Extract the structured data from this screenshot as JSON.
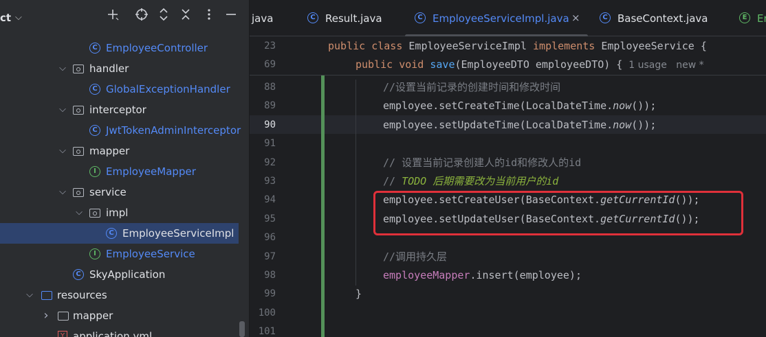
{
  "project_panel": {
    "title": "ct",
    "toolbar_icons": [
      "plus-icon",
      "crosshair-icon",
      "expand-icon",
      "collapse-icon",
      "more-icon",
      "minimize-icon"
    ],
    "tree": [
      {
        "label": "EmployeeController",
        "kind": "class",
        "expanded": null
      },
      {
        "label": "handler",
        "kind": "package",
        "expanded": true
      },
      {
        "label": "GlobalExceptionHandler",
        "kind": "class",
        "expanded": null
      },
      {
        "label": "interceptor",
        "kind": "package",
        "expanded": true
      },
      {
        "label": "JwtTokenAdminInterceptor",
        "kind": "class",
        "expanded": null
      },
      {
        "label": "mapper",
        "kind": "package",
        "expanded": true
      },
      {
        "label": "EmployeeMapper",
        "kind": "interface",
        "expanded": null
      },
      {
        "label": "service",
        "kind": "package",
        "expanded": true
      },
      {
        "label": "impl",
        "kind": "package",
        "expanded": true
      },
      {
        "label": "EmployeeServiceImpl",
        "kind": "class",
        "expanded": null,
        "selected": true
      },
      {
        "label": "EmployeeService",
        "kind": "interface",
        "expanded": null
      },
      {
        "label": "SkyApplication",
        "kind": "app",
        "expanded": null
      },
      {
        "label": "resources",
        "kind": "resources-folder",
        "expanded": true
      },
      {
        "label": "mapper",
        "kind": "folder",
        "expanded": false
      },
      {
        "label": "application.yml",
        "kind": "yaml",
        "expanded": null
      }
    ]
  },
  "editor": {
    "tabs": [
      {
        "label": "java",
        "icon": "none",
        "active": false
      },
      {
        "label": "Result.java",
        "icon": "class-icon",
        "active": false
      },
      {
        "label": "EmployeeServiceImpl.java",
        "icon": "class-icon",
        "active": true,
        "close": "×"
      },
      {
        "label": "BaseContext.java",
        "icon": "class-icon",
        "active": false
      },
      {
        "label": "Er",
        "icon": "enum-icon",
        "active": false
      }
    ],
    "sticky_lines": [
      {
        "num": "23",
        "parts": [
          [
            "public class ",
            "kw"
          ],
          [
            "EmployeeServiceImpl ",
            "cls"
          ],
          [
            "implements ",
            "kw"
          ],
          [
            "EmployeeService {",
            "plain"
          ]
        ]
      },
      {
        "num": "69",
        "parts": [
          [
            "public void ",
            "kw"
          ],
          [
            "save",
            "fn"
          ],
          [
            "(EmployeeDTO employeeDTO) {",
            "plain"
          ]
        ],
        "hints": [
          "1 usage",
          "new *"
        ]
      }
    ],
    "lines": [
      {
        "num": "88",
        "parts": [
          [
            "//设置当前记录的创建时间和修改时间",
            "cm"
          ]
        ]
      },
      {
        "num": "89",
        "parts": [
          [
            "employee.setCreateTime(LocalDateTime.",
            "plain"
          ],
          [
            "now",
            "st"
          ],
          [
            "());",
            "plain"
          ]
        ]
      },
      {
        "num": "90",
        "parts": [
          [
            "employee.setUpdateTime(LocalDateTime.",
            "plain"
          ],
          [
            "now",
            "st"
          ],
          [
            "());",
            "plain"
          ]
        ],
        "current": true
      },
      {
        "num": "91",
        "parts": []
      },
      {
        "num": "92",
        "parts": [
          [
            "// 设置当前记录创建人的id和修改人的id",
            "cm"
          ]
        ]
      },
      {
        "num": "93",
        "parts": [
          [
            "// ",
            "cm"
          ],
          [
            "TODO 后期需要改为当前用户的id",
            "todo"
          ]
        ]
      },
      {
        "num": "94",
        "parts": [
          [
            "employee.setCreateUser(BaseContext.",
            "plain"
          ],
          [
            "getCurrentId",
            "st"
          ],
          [
            "());",
            "plain"
          ]
        ]
      },
      {
        "num": "95",
        "parts": [
          [
            "employee.setUpdateUser(BaseContext.",
            "plain"
          ],
          [
            "getCurrentId",
            "st"
          ],
          [
            "());",
            "plain"
          ]
        ]
      },
      {
        "num": "96",
        "parts": []
      },
      {
        "num": "97",
        "parts": [
          [
            "//调用持久层",
            "cm"
          ]
        ]
      },
      {
        "num": "98",
        "parts": [
          [
            "employeeMapper",
            "fld"
          ],
          [
            ".insert(employee);",
            "plain"
          ]
        ]
      },
      {
        "num": "99",
        "parts": [
          [
            "}",
            "plain"
          ]
        ],
        "indent": 1
      },
      {
        "num": "100",
        "parts": []
      },
      {
        "num": "101",
        "parts": []
      }
    ],
    "highlight_color": "#e0303a"
  }
}
